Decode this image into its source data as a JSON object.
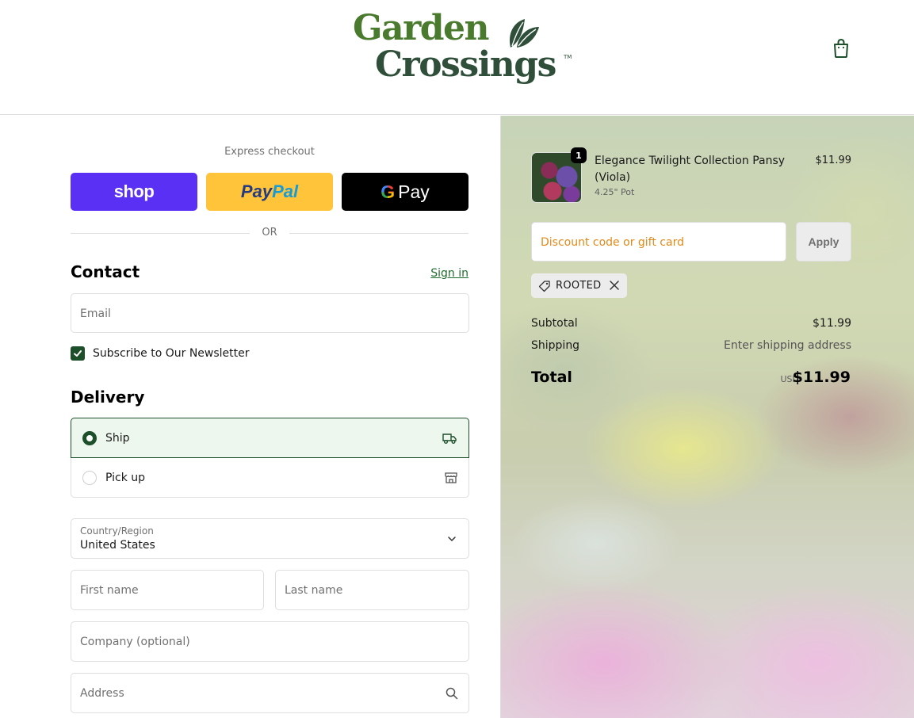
{
  "header": {
    "logo_line1": "Garden",
    "logo_line2": "Crossings",
    "logo_tm": "TM",
    "cart_icon": "shopping-bag-icon"
  },
  "express": {
    "label": "Express checkout",
    "shop_label": "shop",
    "paypal_part1": "Pay",
    "paypal_part2": "Pal",
    "gpay_g": "G",
    "gpay_label": "Pay",
    "or_label": "OR"
  },
  "contact": {
    "heading": "Contact",
    "sign_in": "Sign in",
    "email_placeholder": "Email",
    "newsletter_label": "Subscribe to Our Newsletter",
    "newsletter_checked": true
  },
  "delivery": {
    "heading": "Delivery",
    "options": [
      {
        "label": "Ship",
        "selected": true,
        "icon": "truck-icon"
      },
      {
        "label": "Pick up",
        "selected": false,
        "icon": "store-icon"
      }
    ],
    "country_label": "Country/Region",
    "country_value": "United States",
    "first_name_placeholder": "First name",
    "last_name_placeholder": "Last name",
    "company_placeholder": "Company (optional)",
    "address_placeholder": "Address"
  },
  "order": {
    "item": {
      "name": "Elegance Twilight Collection Pansy (Viola)",
      "variant": "4.25\" Pot",
      "price": "$11.99",
      "quantity": "1"
    },
    "discount_placeholder": "Discount code or gift card",
    "apply_label": "Apply",
    "applied_code": "ROOTED",
    "subtotal_label": "Subtotal",
    "subtotal_value": "$11.99",
    "shipping_label": "Shipping",
    "shipping_value": "Enter shipping address",
    "total_label": "Total",
    "total_currency": "USD",
    "total_value": "$11.99"
  },
  "colors": {
    "accent": "#1d4f2b",
    "shop_purple": "#5a31f4",
    "paypal_yellow": "#ffc439",
    "discount_placeholder": "#e08a1a"
  }
}
